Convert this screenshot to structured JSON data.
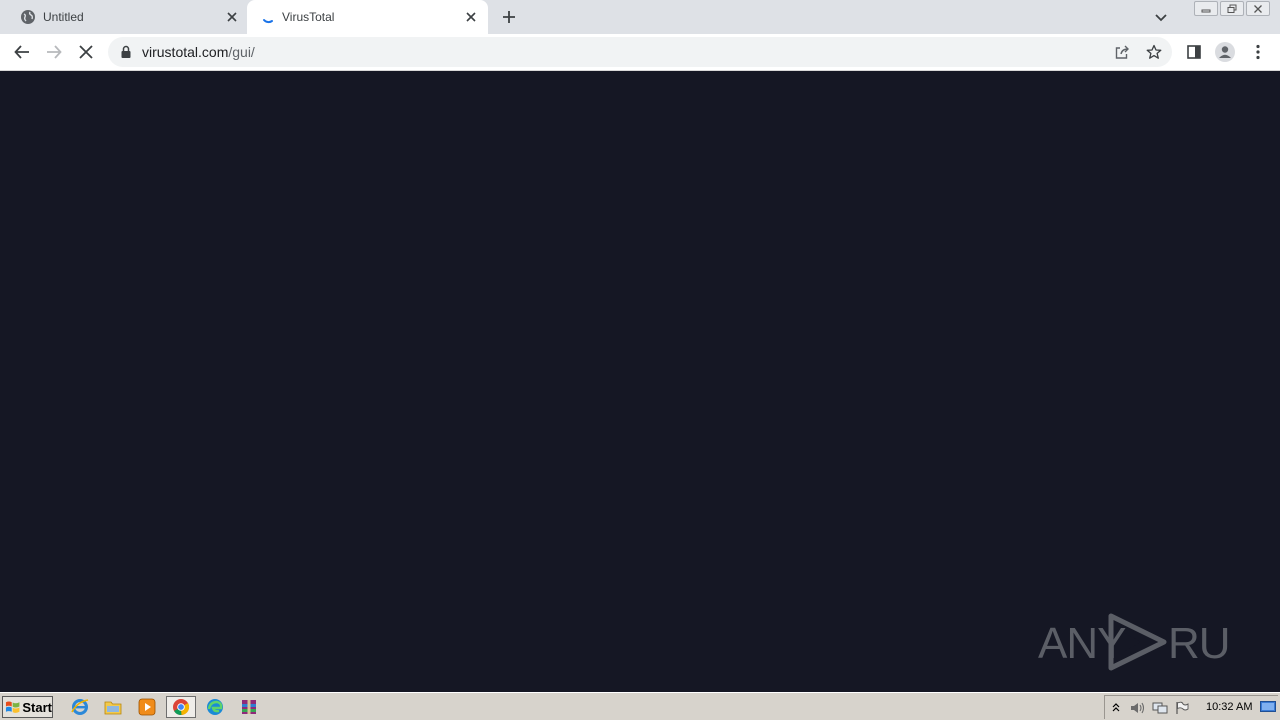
{
  "browser": {
    "tabs": [
      {
        "title": "Untitled",
        "favicon": "globe-icon",
        "active": false
      },
      {
        "title": "VirusTotal",
        "favicon": "loading-spinner-icon",
        "active": true
      }
    ],
    "address": {
      "domain": "virustotal.com",
      "path": "/gui/"
    },
    "toolbar_icons": [
      "back-arrow-icon",
      "forward-arrow-icon",
      "stop-loading-icon",
      "lock-icon",
      "share-icon",
      "bookmark-star-icon",
      "side-panel-icon",
      "profile-icon",
      "menu-dots-icon"
    ]
  },
  "content": {
    "background_color": "#151724",
    "watermark": {
      "text_left": "ANY",
      "text_right": "RUN"
    }
  },
  "taskbar": {
    "start_label": "Start",
    "apps": [
      "internet-explorer-icon",
      "explorer-folder-icon",
      "media-player-icon",
      "chrome-icon",
      "edge-icon",
      "winrar-icon"
    ],
    "active_app": "chrome-icon",
    "clock": "10:32 AM"
  }
}
